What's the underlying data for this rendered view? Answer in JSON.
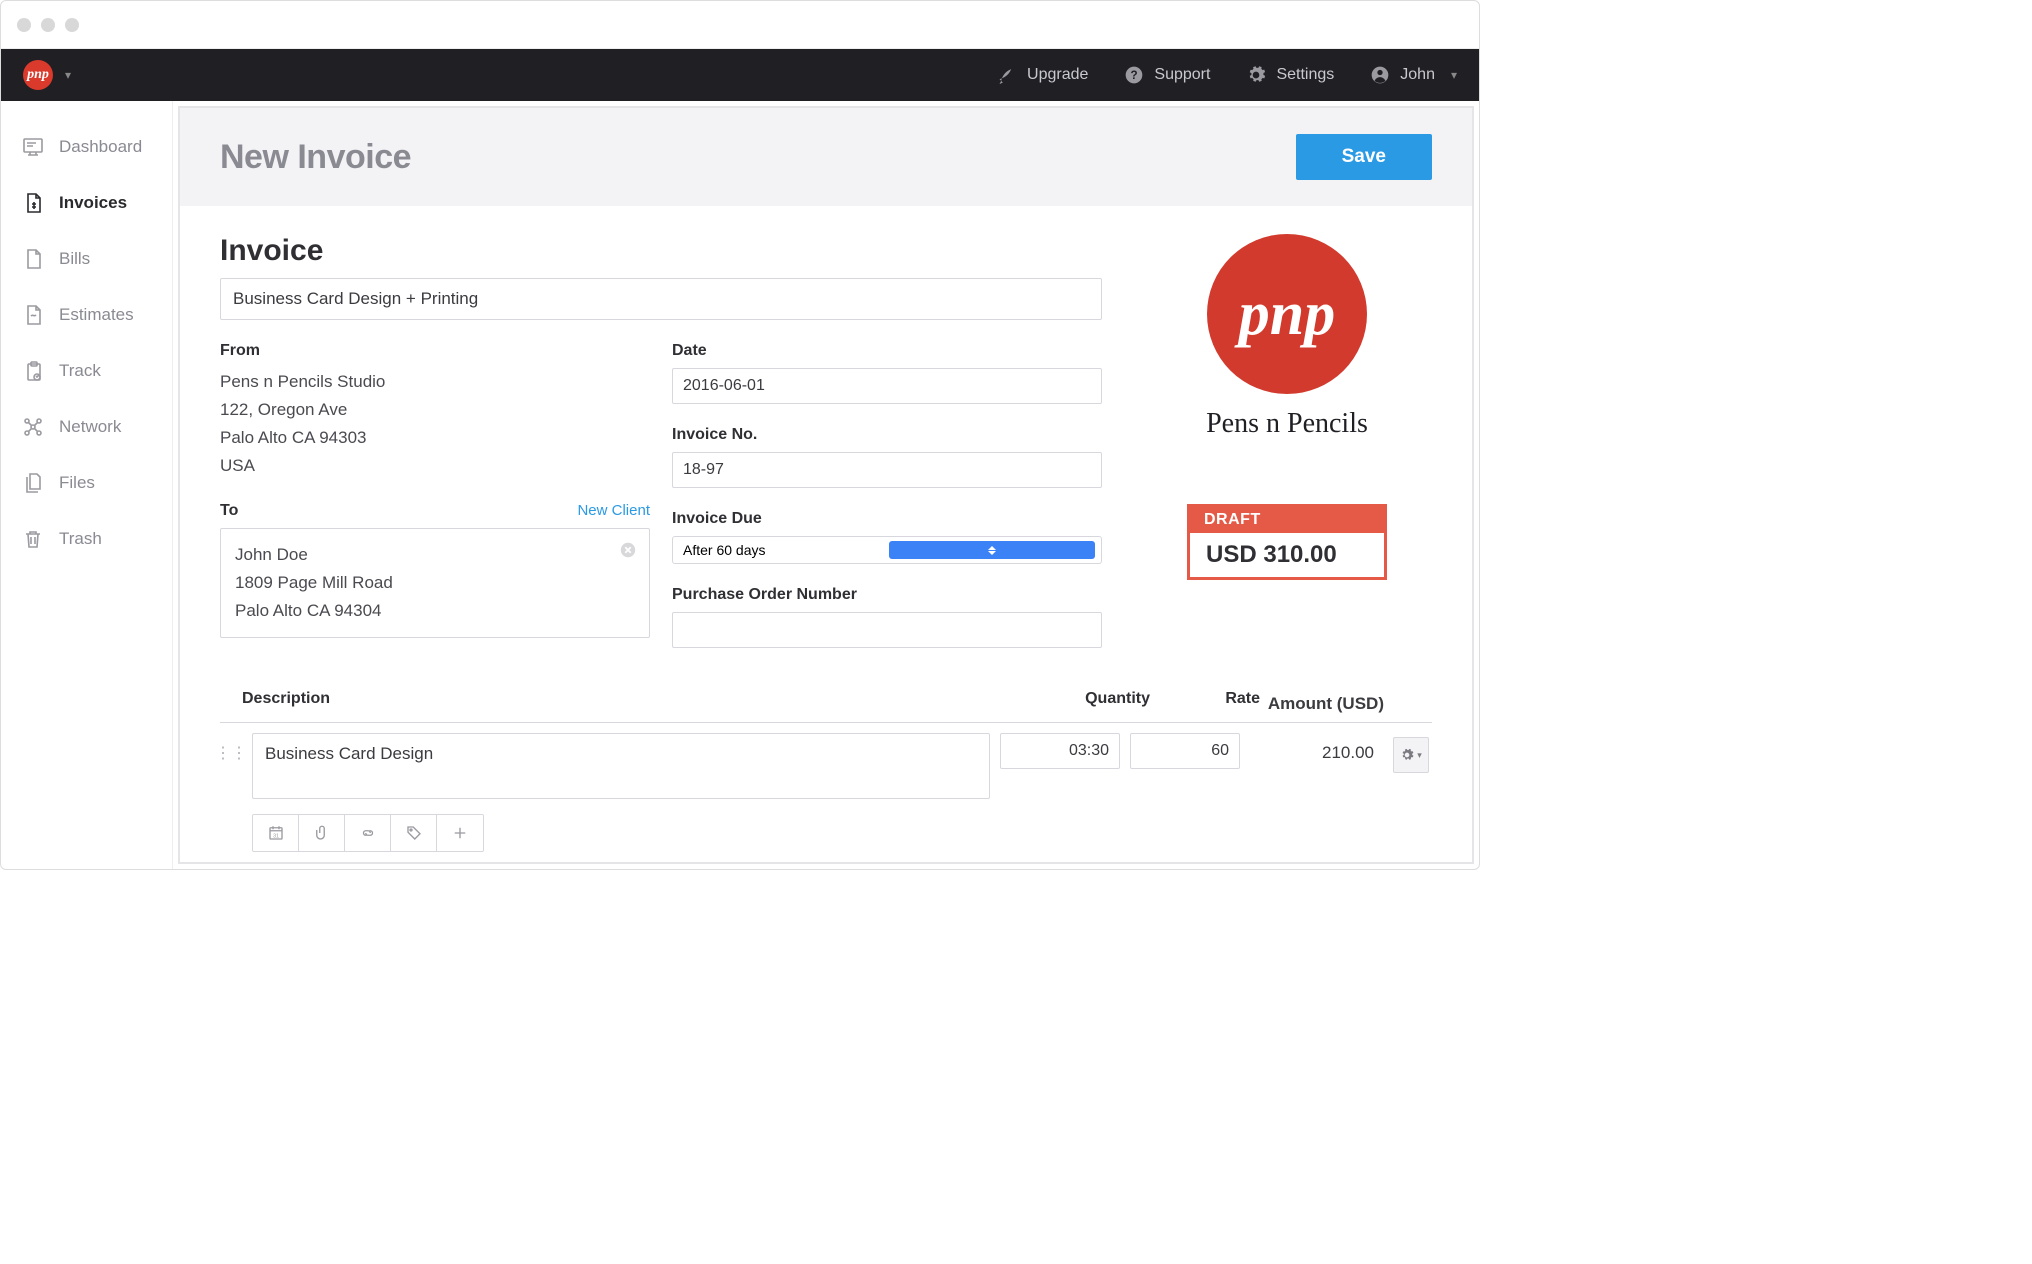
{
  "topnav": {
    "upgrade": "Upgrade",
    "support": "Support",
    "settings": "Settings",
    "user": "John"
  },
  "sidebar": {
    "items": [
      {
        "key": "dashboard",
        "label": "Dashboard"
      },
      {
        "key": "invoices",
        "label": "Invoices"
      },
      {
        "key": "bills",
        "label": "Bills"
      },
      {
        "key": "estimates",
        "label": "Estimates"
      },
      {
        "key": "track",
        "label": "Track"
      },
      {
        "key": "network",
        "label": "Network"
      },
      {
        "key": "files",
        "label": "Files"
      },
      {
        "key": "trash",
        "label": "Trash"
      }
    ],
    "active_key": "invoices"
  },
  "header": {
    "title": "New Invoice",
    "save_label": "Save"
  },
  "invoice": {
    "section_title": "Invoice",
    "subject": "Business Card Design + Printing",
    "from_label": "From",
    "from": {
      "name": "Pens n Pencils Studio",
      "addr1": "122, Oregon Ave",
      "addr2": "Palo Alto CA 94303",
      "country": "USA"
    },
    "to_label": "To",
    "new_client_label": "New Client",
    "to": {
      "name": "John Doe",
      "addr1": "1809 Page Mill Road",
      "addr2": "Palo Alto CA 94304"
    },
    "date_label": "Date",
    "date": "2016-06-01",
    "invoice_no_label": "Invoice No.",
    "invoice_no": "18-97",
    "invoice_due_label": "Invoice Due",
    "invoice_due": "After 60 days",
    "po_label": "Purchase Order Number",
    "po": ""
  },
  "brand": {
    "logo_text": "pnp",
    "name": "Pens n Pencils"
  },
  "status": {
    "badge": "DRAFT",
    "amount": "USD 310.00"
  },
  "lines": {
    "headers": {
      "description": "Description",
      "quantity": "Quantity",
      "rate": "Rate",
      "amount": "Amount (USD)"
    },
    "rows": [
      {
        "description": "Business Card Design",
        "quantity": "03:30",
        "rate": "60",
        "amount": "210.00"
      }
    ]
  }
}
